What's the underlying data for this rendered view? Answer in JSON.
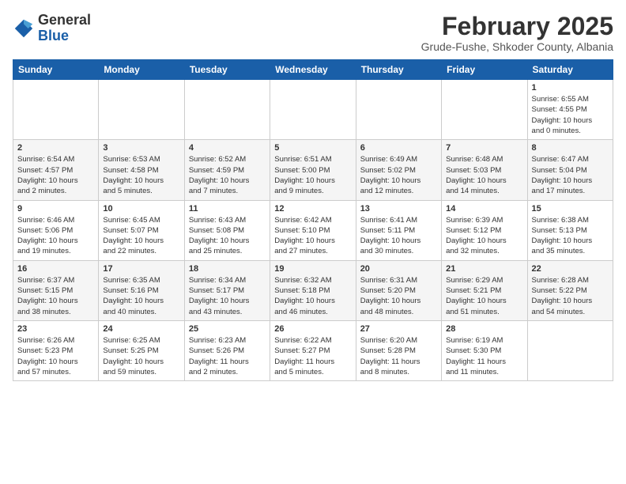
{
  "header": {
    "logo_general": "General",
    "logo_blue": "Blue",
    "month_year": "February 2025",
    "location": "Grude-Fushe, Shkoder County, Albania"
  },
  "days_of_week": [
    "Sunday",
    "Monday",
    "Tuesday",
    "Wednesday",
    "Thursday",
    "Friday",
    "Saturday"
  ],
  "weeks": [
    [
      {
        "day": "",
        "info": ""
      },
      {
        "day": "",
        "info": ""
      },
      {
        "day": "",
        "info": ""
      },
      {
        "day": "",
        "info": ""
      },
      {
        "day": "",
        "info": ""
      },
      {
        "day": "",
        "info": ""
      },
      {
        "day": "1",
        "info": "Sunrise: 6:55 AM\nSunset: 4:55 PM\nDaylight: 10 hours\nand 0 minutes."
      }
    ],
    [
      {
        "day": "2",
        "info": "Sunrise: 6:54 AM\nSunset: 4:57 PM\nDaylight: 10 hours\nand 2 minutes."
      },
      {
        "day": "3",
        "info": "Sunrise: 6:53 AM\nSunset: 4:58 PM\nDaylight: 10 hours\nand 5 minutes."
      },
      {
        "day": "4",
        "info": "Sunrise: 6:52 AM\nSunset: 4:59 PM\nDaylight: 10 hours\nand 7 minutes."
      },
      {
        "day": "5",
        "info": "Sunrise: 6:51 AM\nSunset: 5:00 PM\nDaylight: 10 hours\nand 9 minutes."
      },
      {
        "day": "6",
        "info": "Sunrise: 6:49 AM\nSunset: 5:02 PM\nDaylight: 10 hours\nand 12 minutes."
      },
      {
        "day": "7",
        "info": "Sunrise: 6:48 AM\nSunset: 5:03 PM\nDaylight: 10 hours\nand 14 minutes."
      },
      {
        "day": "8",
        "info": "Sunrise: 6:47 AM\nSunset: 5:04 PM\nDaylight: 10 hours\nand 17 minutes."
      }
    ],
    [
      {
        "day": "9",
        "info": "Sunrise: 6:46 AM\nSunset: 5:06 PM\nDaylight: 10 hours\nand 19 minutes."
      },
      {
        "day": "10",
        "info": "Sunrise: 6:45 AM\nSunset: 5:07 PM\nDaylight: 10 hours\nand 22 minutes."
      },
      {
        "day": "11",
        "info": "Sunrise: 6:43 AM\nSunset: 5:08 PM\nDaylight: 10 hours\nand 25 minutes."
      },
      {
        "day": "12",
        "info": "Sunrise: 6:42 AM\nSunset: 5:10 PM\nDaylight: 10 hours\nand 27 minutes."
      },
      {
        "day": "13",
        "info": "Sunrise: 6:41 AM\nSunset: 5:11 PM\nDaylight: 10 hours\nand 30 minutes."
      },
      {
        "day": "14",
        "info": "Sunrise: 6:39 AM\nSunset: 5:12 PM\nDaylight: 10 hours\nand 32 minutes."
      },
      {
        "day": "15",
        "info": "Sunrise: 6:38 AM\nSunset: 5:13 PM\nDaylight: 10 hours\nand 35 minutes."
      }
    ],
    [
      {
        "day": "16",
        "info": "Sunrise: 6:37 AM\nSunset: 5:15 PM\nDaylight: 10 hours\nand 38 minutes."
      },
      {
        "day": "17",
        "info": "Sunrise: 6:35 AM\nSunset: 5:16 PM\nDaylight: 10 hours\nand 40 minutes."
      },
      {
        "day": "18",
        "info": "Sunrise: 6:34 AM\nSunset: 5:17 PM\nDaylight: 10 hours\nand 43 minutes."
      },
      {
        "day": "19",
        "info": "Sunrise: 6:32 AM\nSunset: 5:18 PM\nDaylight: 10 hours\nand 46 minutes."
      },
      {
        "day": "20",
        "info": "Sunrise: 6:31 AM\nSunset: 5:20 PM\nDaylight: 10 hours\nand 48 minutes."
      },
      {
        "day": "21",
        "info": "Sunrise: 6:29 AM\nSunset: 5:21 PM\nDaylight: 10 hours\nand 51 minutes."
      },
      {
        "day": "22",
        "info": "Sunrise: 6:28 AM\nSunset: 5:22 PM\nDaylight: 10 hours\nand 54 minutes."
      }
    ],
    [
      {
        "day": "23",
        "info": "Sunrise: 6:26 AM\nSunset: 5:23 PM\nDaylight: 10 hours\nand 57 minutes."
      },
      {
        "day": "24",
        "info": "Sunrise: 6:25 AM\nSunset: 5:25 PM\nDaylight: 10 hours\nand 59 minutes."
      },
      {
        "day": "25",
        "info": "Sunrise: 6:23 AM\nSunset: 5:26 PM\nDaylight: 11 hours\nand 2 minutes."
      },
      {
        "day": "26",
        "info": "Sunrise: 6:22 AM\nSunset: 5:27 PM\nDaylight: 11 hours\nand 5 minutes."
      },
      {
        "day": "27",
        "info": "Sunrise: 6:20 AM\nSunset: 5:28 PM\nDaylight: 11 hours\nand 8 minutes."
      },
      {
        "day": "28",
        "info": "Sunrise: 6:19 AM\nSunset: 5:30 PM\nDaylight: 11 hours\nand 11 minutes."
      },
      {
        "day": "",
        "info": ""
      }
    ]
  ]
}
